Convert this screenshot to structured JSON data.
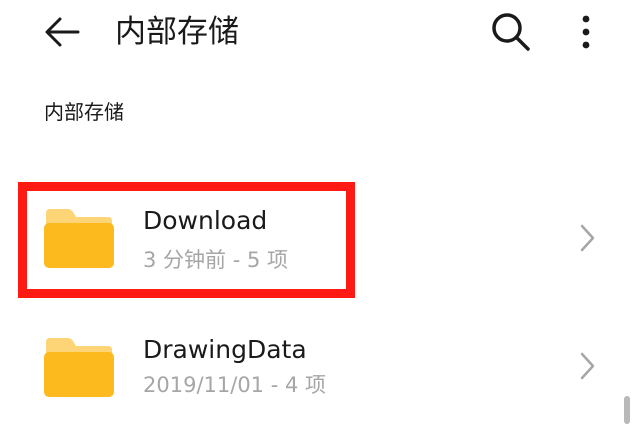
{
  "app_bar": {
    "title": "内部存储",
    "back_icon": "arrow-left-icon",
    "search_icon": "search-icon",
    "more_icon": "more-vertical-icon"
  },
  "breadcrumb": {
    "label": "内部存储"
  },
  "files": [
    {
      "name": "Download",
      "meta": "3 分钟前 - 5 项",
      "icon": "folder-icon"
    },
    {
      "name": "DrawingData",
      "meta": "2019/11/01 - 4 项",
      "icon": "folder-icon"
    }
  ],
  "colors": {
    "folder": "#FDBA1F",
    "folder_tab": "#FDD577",
    "highlight": "#FF1A14",
    "secondary_text": "#A6A6A6"
  }
}
